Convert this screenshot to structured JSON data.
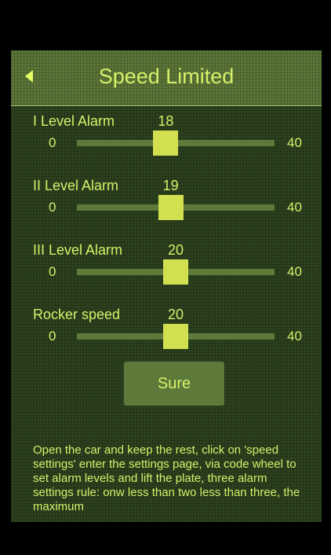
{
  "header": {
    "title": "Speed Limited",
    "back_icon": "back-triangle-icon"
  },
  "sliders": [
    {
      "label": "I Level Alarm",
      "value": "18",
      "min": "0",
      "max": "40"
    },
    {
      "label": "II Level Alarm",
      "value": "19",
      "min": "0",
      "max": "40"
    },
    {
      "label": "III Level Alarm",
      "value": "20",
      "min": "0",
      "max": "40"
    },
    {
      "label": "Rocker speed",
      "value": "20",
      "min": "0",
      "max": "40"
    }
  ],
  "confirm": {
    "label": "Sure"
  },
  "description": "Open the car and keep the rest, click on 'speed settings' enter the settings page, via code wheel to set alarm levels and lift the plate, three alarm settings rule: onw less than two less than three, the maximum",
  "colors": {
    "text": "#d6f06a",
    "background": "#2c421f",
    "header": "#5b7637",
    "thumb": "#d2e04f",
    "track": "#5e7a3a"
  }
}
